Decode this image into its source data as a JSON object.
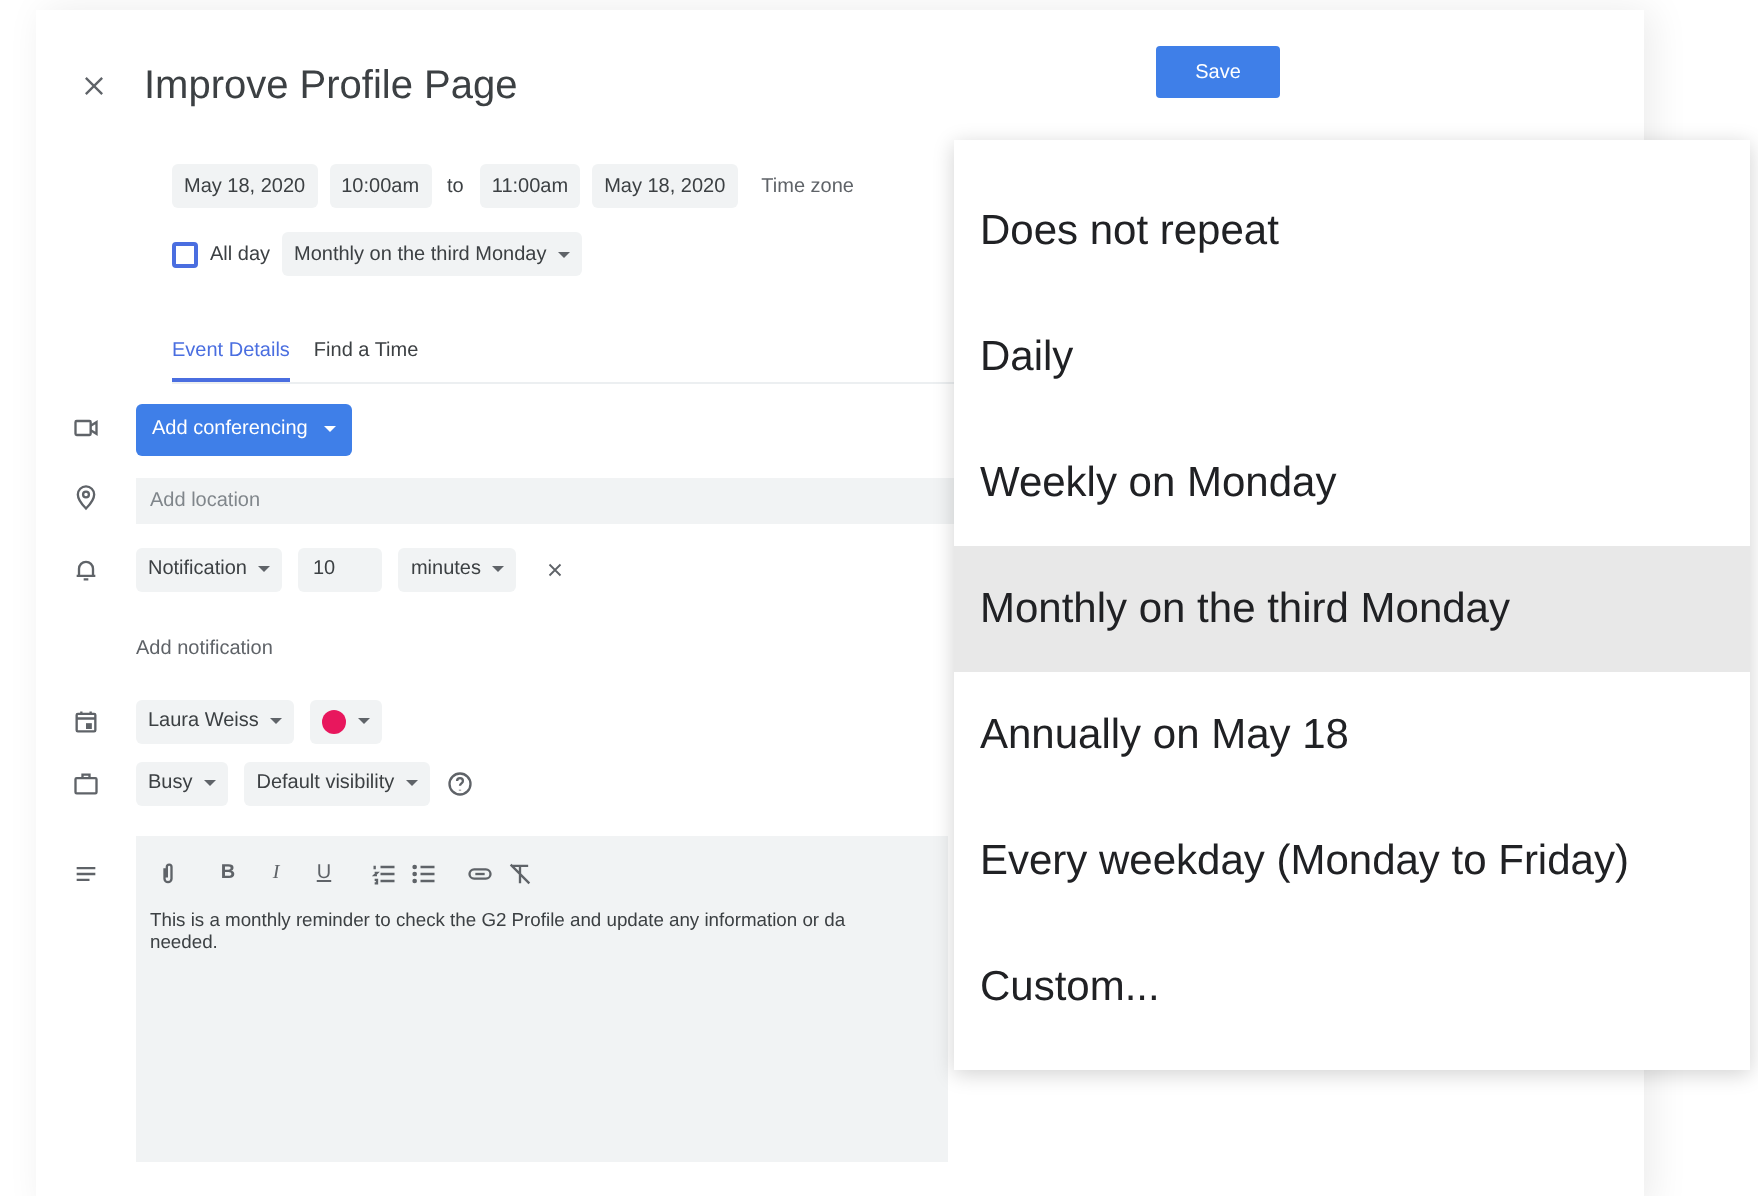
{
  "title": "Improve Profile Page",
  "save_button": "Save",
  "datetime": {
    "start_date": "May 18, 2020",
    "start_time": "10:00am",
    "separator": "to",
    "end_time": "11:00am",
    "end_date": "May 18, 2020",
    "time_zone": "Time zone"
  },
  "all_day": {
    "label": "All day",
    "checked": false
  },
  "recurrence": "Monthly on the third Monday",
  "tabs": [
    {
      "label": "Event Details",
      "selected": true
    },
    {
      "label": "Find a Time",
      "selected": false
    }
  ],
  "conferencing_button": "Add conferencing",
  "location": {
    "placeholder": "Add location"
  },
  "notification": {
    "type": "Notification",
    "value": "10",
    "unit": "minutes"
  },
  "add_notification": "Add notification",
  "calendar": {
    "owner": "Laura Weiss",
    "color": "#e8175d"
  },
  "availability": {
    "status": "Busy",
    "visibility": "Default visibility"
  },
  "format_buttons": [
    "B",
    "I",
    "U"
  ],
  "description": {
    "lines": [
      "This is a monthly reminder to check the G2 Profile and update any information or da",
      "needed."
    ]
  },
  "repeat_menu": {
    "items": [
      {
        "label": "Does not repeat",
        "selected": false
      },
      {
        "label": "Daily",
        "selected": false
      },
      {
        "label": "Weekly on Monday",
        "selected": false
      },
      {
        "label": "Monthly on the third Monday",
        "selected": true
      },
      {
        "label": "Annually on May 18",
        "selected": false
      },
      {
        "label": "Every weekday (Monday to Friday)",
        "selected": false
      },
      {
        "label": "Custom...",
        "selected": false
      }
    ]
  }
}
